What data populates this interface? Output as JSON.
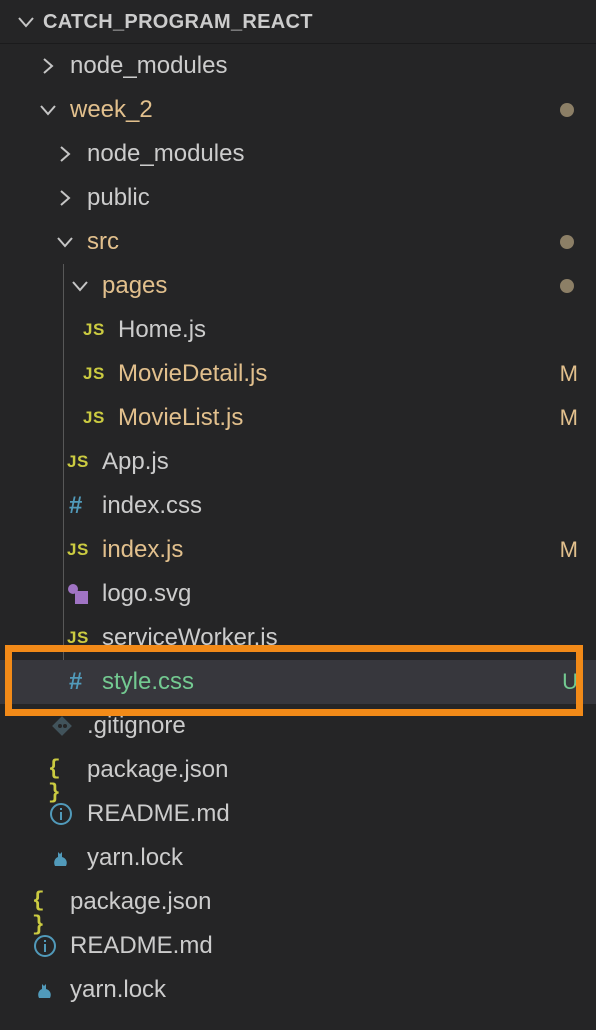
{
  "explorer": {
    "root_title": "CATCH_PROGRAM_REACT",
    "items": [
      {
        "label": "node_modules",
        "state": "normal",
        "badge": "",
        "icon": "chevron-right-icon"
      },
      {
        "label": "week_2",
        "state": "modified",
        "badge": "",
        "icon": "chevron-down-icon"
      },
      {
        "label": "node_modules",
        "state": "normal",
        "badge": "",
        "icon": "chevron-right-icon"
      },
      {
        "label": "public",
        "state": "normal",
        "badge": "",
        "icon": "chevron-right-icon"
      },
      {
        "label": "src",
        "state": "modified",
        "badge": "",
        "icon": "chevron-down-icon"
      },
      {
        "label": "pages",
        "state": "modified",
        "badge": "",
        "icon": "chevron-down-icon"
      },
      {
        "label": "Home.js",
        "state": "normal",
        "badge": "",
        "icon": "js-icon"
      },
      {
        "label": "MovieDetail.js",
        "state": "modified",
        "badge": "M",
        "icon": "js-icon"
      },
      {
        "label": "MovieList.js",
        "state": "modified",
        "badge": "M",
        "icon": "js-icon"
      },
      {
        "label": "App.js",
        "state": "normal",
        "badge": "",
        "icon": "js-icon"
      },
      {
        "label": "index.css",
        "state": "normal",
        "badge": "",
        "icon": "css-hash-icon"
      },
      {
        "label": "index.js",
        "state": "modified",
        "badge": "M",
        "icon": "js-icon"
      },
      {
        "label": "logo.svg",
        "state": "normal",
        "badge": "",
        "icon": "svg-shapes-icon"
      },
      {
        "label": "serviceWorker.js",
        "state": "normal",
        "badge": "",
        "icon": "js-icon"
      },
      {
        "label": "style.css",
        "state": "untracked",
        "badge": "U",
        "icon": "css-hash-icon"
      },
      {
        "label": ".gitignore",
        "state": "normal",
        "badge": "",
        "icon": "git-diamond-icon"
      },
      {
        "label": "package.json",
        "state": "normal",
        "badge": "",
        "icon": "json-braces-icon"
      },
      {
        "label": "README.md",
        "state": "normal",
        "badge": "",
        "icon": "info-icon"
      },
      {
        "label": "yarn.lock",
        "state": "normal",
        "badge": "",
        "icon": "yarn-cat-icon"
      },
      {
        "label": "package.json",
        "state": "normal",
        "badge": "",
        "icon": "json-braces-icon"
      },
      {
        "label": "README.md",
        "state": "normal",
        "badge": "",
        "icon": "info-icon"
      },
      {
        "label": "yarn.lock",
        "state": "normal",
        "badge": "",
        "icon": "yarn-cat-icon"
      }
    ],
    "icon_glyphs": {
      "js": "JS",
      "hash": "#",
      "braces": "{ }"
    },
    "colors": {
      "background": "#252526",
      "selected_row": "#37373d",
      "text": "#cccccc",
      "modified": "#e2c08d",
      "untracked": "#73c991",
      "js_yellow": "#cbcb41",
      "css_blue": "#519aba",
      "svg_purple": "#a074c4",
      "highlight_box": "#f28a18"
    }
  }
}
